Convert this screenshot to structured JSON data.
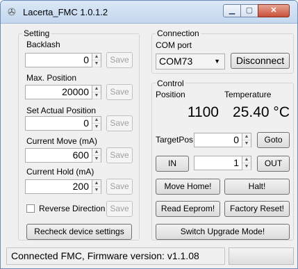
{
  "window": {
    "title": "Lacerta_FMC 1.0.1.2"
  },
  "setting": {
    "group_label": "Setting",
    "backlash": {
      "label": "Backlash",
      "value": "0",
      "save": "Save"
    },
    "max_position": {
      "label": "Max. Position",
      "value": "20000",
      "save": "Save"
    },
    "set_actual_position": {
      "label": "Set Actual Position",
      "value": "0",
      "save": "Save"
    },
    "current_move": {
      "label": "Current Move (mA)",
      "value": "600",
      "save": "Save"
    },
    "current_hold": {
      "label": "Current Hold (mA)",
      "value": "200",
      "save": "Save"
    },
    "reverse": {
      "label": "Reverse Direction",
      "save": "Save"
    },
    "recheck_button": "Recheck device settings"
  },
  "connection": {
    "group_label": "Connection",
    "com_label": "COM port",
    "com_value": "COM73",
    "disconnect_button": "Disconnect"
  },
  "control": {
    "group_label": "Control",
    "position_label": "Position",
    "position_value": "1100",
    "temperature_label": "Temperature",
    "temperature_value": "25.40 °C",
    "targetpos_label": "TargetPos.:",
    "targetpos_value": "0",
    "goto_button": "Goto",
    "in_button": "IN",
    "step_value": "1",
    "out_button": "OUT",
    "move_home_button": "Move Home!",
    "halt_button": "Halt!",
    "read_eeprom_button": "Read Eeprom!",
    "factory_reset_button": "Factory Reset!",
    "switch_upgrade_button": "Switch Upgrade Mode!"
  },
  "status": {
    "text": "Connected FMC, Firmware version: v1.1.08"
  }
}
